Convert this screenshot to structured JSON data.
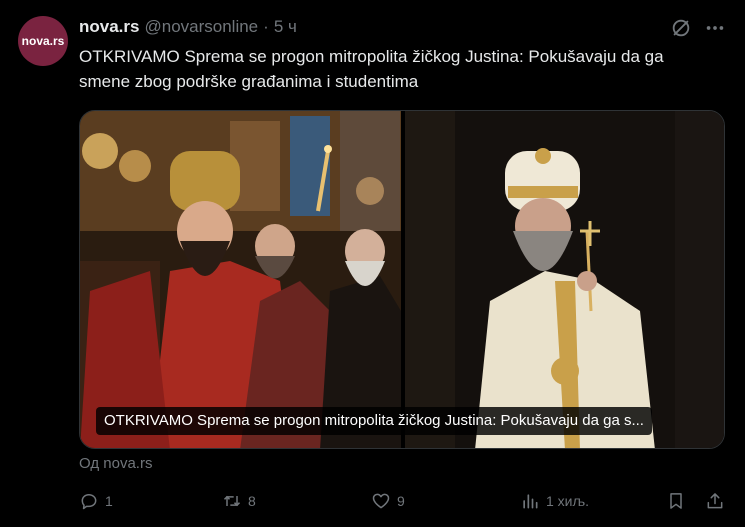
{
  "account": {
    "avatar_text": "nova.rs",
    "display_name": "nova.rs",
    "handle": "@novarsonline",
    "separator": "·",
    "time": "5 ч"
  },
  "tweet": {
    "text": "OTKRIVAMO Sprema se progon mitropolita žičkog Justina: Pokušavaju da ga smene zbog podrške građanima i studentima"
  },
  "media": {
    "caption": "OTKRIVAMO Sprema se progon mitropolita žičkog Justina: Pokušavaju da ga s..."
  },
  "source": {
    "label": "Од nova.rs"
  },
  "actions": {
    "reply_count": "1",
    "retweet_count": "8",
    "like_count": "9",
    "views_count": "1 хиљ."
  },
  "colors": {
    "background": "#000000",
    "text_primary": "#e7e9ea",
    "text_secondary": "#71767b",
    "avatar": "#7a2340",
    "border": "#2f3336"
  },
  "icons": {
    "header": [
      "grok-icon",
      "more-icon"
    ],
    "actions": [
      "reply-icon",
      "retweet-icon",
      "like-icon",
      "views-icon",
      "bookmark-icon",
      "share-icon"
    ]
  }
}
